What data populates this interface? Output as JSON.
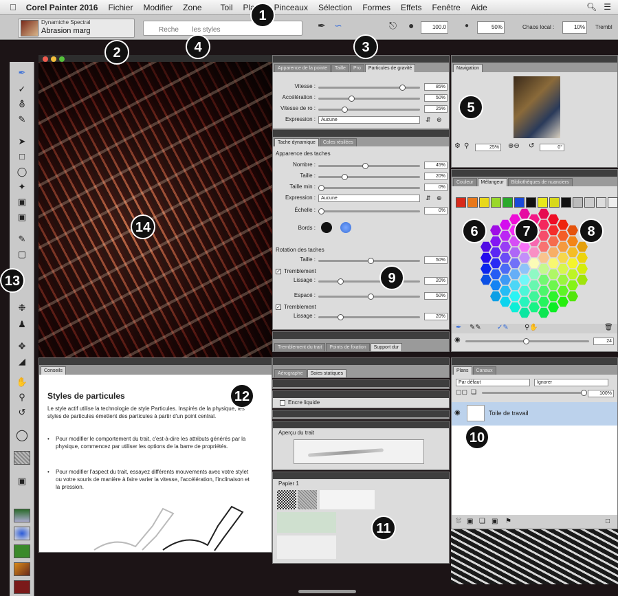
{
  "menubar": {
    "apple": "",
    "app": "Corel Painter 2016",
    "items": [
      "Fichier",
      "Modifier",
      "Zone",
      "Toil",
      "Plans",
      "Pinceaux",
      "Sélection",
      "Formes",
      "Effets",
      "Fenêtre",
      "Aide"
    ],
    "right_icons": [
      "search-icon",
      "list-icon"
    ]
  },
  "propbar": {
    "brush_category": "Dynamiche Spectral",
    "brush_variant": "Abrasion marg",
    "search_placeholder": "Reche       les styles",
    "opacity": "100.0",
    "grain": "50%",
    "chaos_label": "Chaos local :",
    "chaos_value": "10%",
    "trem_label": "Trembl"
  },
  "callouts": [
    "1",
    "2",
    "3",
    "4",
    "5",
    "6",
    "7",
    "8",
    "9",
    "10",
    "11",
    "12",
    "13",
    "14"
  ],
  "particles_panel": {
    "tabs": [
      "Apparence de la pointe",
      "Taille",
      "Pro",
      "Particules de gravité"
    ],
    "rows": [
      {
        "label": "Vitesse :",
        "value": "85%",
        "pos": 0.83
      },
      {
        "label": "Accélération :",
        "value": "50%",
        "pos": 0.32
      },
      {
        "label": "Vitesse de ro :",
        "value": "25%",
        "pos": 0.24
      }
    ],
    "expression_label": "Expression :",
    "expression_value": "Aucune"
  },
  "dynamic_panel": {
    "tabs": [
      "Tache dynamique",
      "Coles résilées"
    ],
    "section1": "Apparence des taches",
    "rows": [
      {
        "label": "Nombre :",
        "value": "45%",
        "pos": 0.45
      },
      {
        "label": "Taille :",
        "value": "20%",
        "pos": 0.22
      },
      {
        "label": "Taille min :",
        "value": "0%",
        "pos": 0.0
      }
    ],
    "expression_label": "Expression :",
    "expression_value": "Aucune",
    "echelle_label": "Échelle :",
    "echelle_value": "0%",
    "bords_label": "Bords :",
    "section2": "Rotation des taches",
    "taille2_label": "Taille :",
    "taille2_value": "50%",
    "trem1_label": "Tremblement",
    "lissage1_label": "Lissage :",
    "lissage1_value": "20%",
    "espace_label": "Espacé :",
    "espace_value": "50%",
    "trem2_label": "Tremblement",
    "lissage2_label": "Lissage :",
    "lissage2_value": "20%",
    "checkmark": "✓"
  },
  "bottom_tabs": [
    "Tremblement du trait",
    "Points de fixation",
    "Support dur"
  ],
  "static_panel": {
    "tabs": [
      "Aérographe",
      "Soies statiques"
    ]
  },
  "ink_panel": {
    "label": "Encre liquide"
  },
  "preview_panel": {
    "label": "Aperçu du trait"
  },
  "papers_panel": {
    "label": "Papier 1"
  },
  "navigator": {
    "tab": "Navigation",
    "zoom": "25%",
    "rotation": "0°"
  },
  "color_panel": {
    "tabs": [
      "Couleur",
      "Mélangeur",
      "Bibliothèques de nuanciers"
    ],
    "size_value": "24"
  },
  "layers_panel": {
    "tabs": [
      "Plans",
      "Canaux"
    ],
    "mode": "Par défaut",
    "composite": "Ignorer",
    "opacity": "100%",
    "layer_name": "Toile de travail"
  },
  "tips_panel": {
    "tab": "Conseils",
    "title": "Styles de particules",
    "intro": "Le style actif utilise la technologie de style Particules. Inspirés de la physique, les styles de particules émettent des particules à partir d'un point central.",
    "bullets": [
      "Pour modifier le comportement du trait, c'est-à-dire les attributs générés par la physique, commencez par utiliser les options de la barre de propriétés.",
      "Pour modifier l'aspect du trait, essayez différents mouvements avec votre stylet ou votre souris de manière à faire varier la vitesse, l'accélération, l'inclinaison et la pression."
    ]
  },
  "colors": {
    "accent": "#3a6fd8",
    "panel_bg": "#dcdcdc",
    "panel_header": "#3e3e3e"
  }
}
